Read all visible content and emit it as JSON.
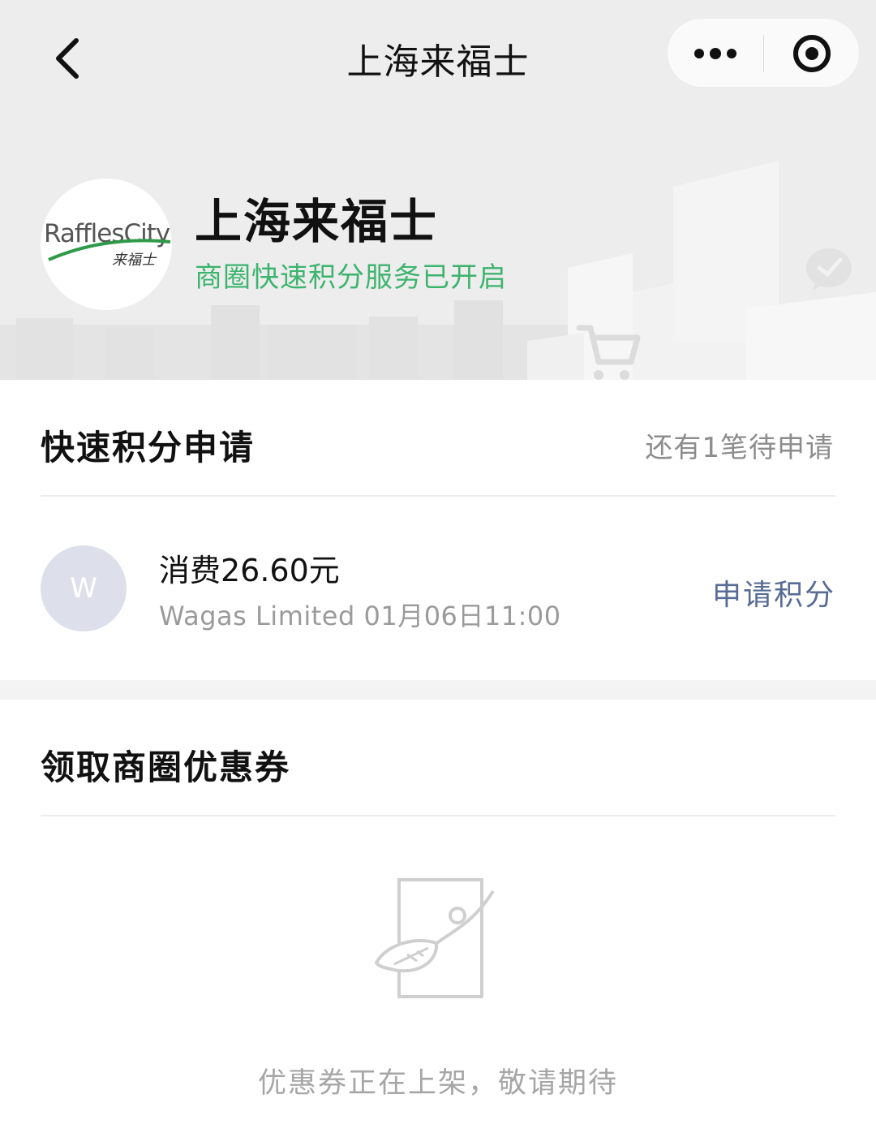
{
  "nav": {
    "title": "上海来福士"
  },
  "mall": {
    "logo_text": "RafflesCity",
    "logo_subtext": "来福士",
    "name": "上海来福士",
    "status": "商圈快速积分服务已开启"
  },
  "points": {
    "title": "快速积分申请",
    "pending": "还有1笔待申请",
    "transaction": {
      "avatar_letter": "W",
      "amount": "消费26.60元",
      "meta": "Wagas Limited 01月06日11:00",
      "action": "申请积分"
    }
  },
  "coupons": {
    "title": "领取商圈优惠券",
    "empty_text": "优惠券正在上架，敬请期待"
  },
  "colors": {
    "brand_green": "#3cb46e",
    "link_blue": "#576b95"
  }
}
